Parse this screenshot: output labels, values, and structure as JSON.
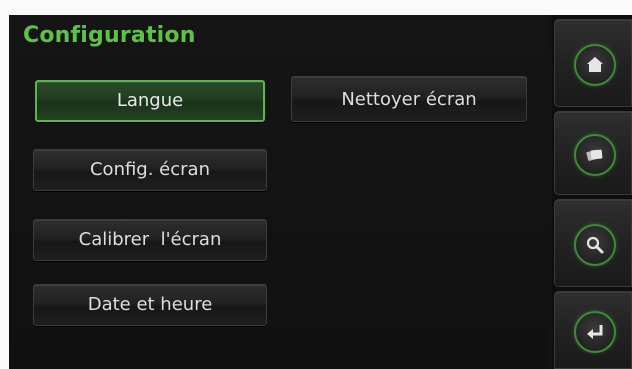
{
  "page": {
    "title": "Configuration"
  },
  "buttons": {
    "langue": "Langue",
    "config_ecran": "Config. écran",
    "calibrer": "Calibrer  l'écran",
    "date_heure": "Date et heure",
    "nettoyer": "Nettoyer écran"
  },
  "selected_button": "langue",
  "sidebar": {
    "icons": [
      "home-icon",
      "cards-icon",
      "magnifier-icon",
      "return-arrow-icon"
    ]
  },
  "colors": {
    "accent": "#5cc24a",
    "background": "#131313",
    "button_text": "#dedede",
    "icon": "#e6e6e6"
  }
}
